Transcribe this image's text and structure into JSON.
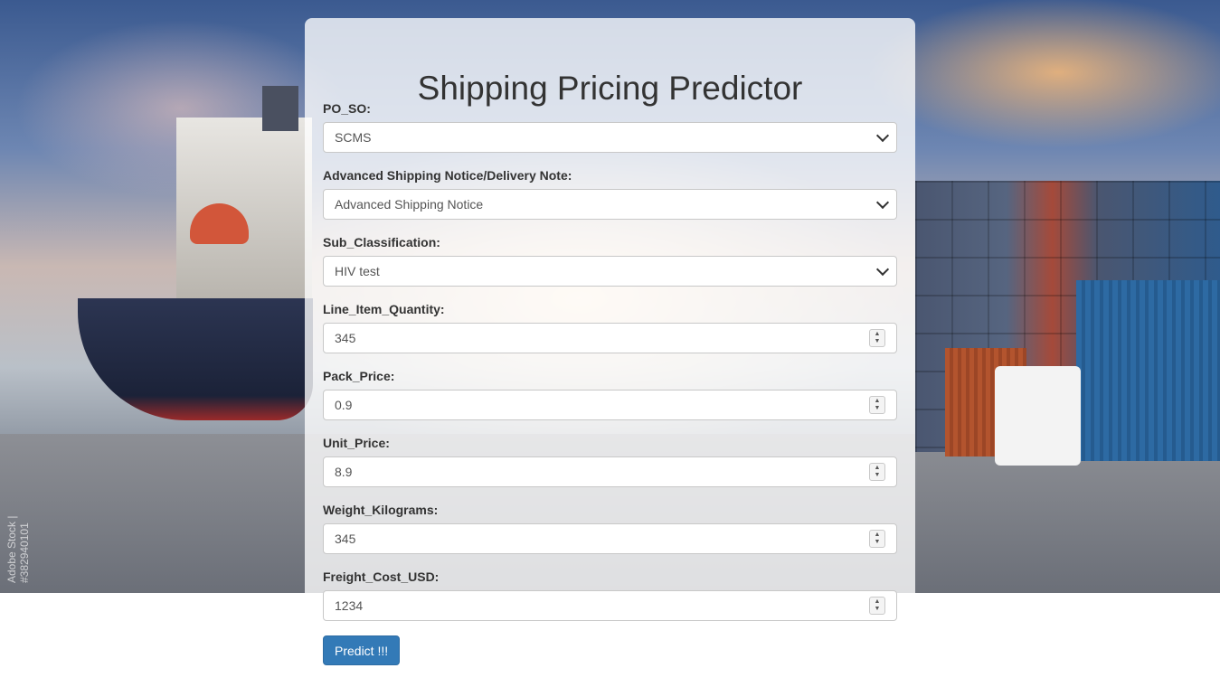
{
  "page": {
    "title": "Shipping Pricing Predictor"
  },
  "background": {
    "watermark": "Adobe Stock | #382940101"
  },
  "form": {
    "fields": [
      {
        "label": "PO_SO:",
        "type": "select",
        "value": "SCMS"
      },
      {
        "label": "Advanced Shipping Notice/Delivery Note:",
        "type": "select",
        "value": "Advanced Shipping Notice"
      },
      {
        "label": "Sub_Classification:",
        "type": "select",
        "value": "HIV test"
      },
      {
        "label": "Line_Item_Quantity:",
        "type": "number",
        "value": "345"
      },
      {
        "label": "Pack_Price:",
        "type": "number",
        "value": "0.9"
      },
      {
        "label": "Unit_Price:",
        "type": "number",
        "value": "8.9"
      },
      {
        "label": "Weight_Kilograms:",
        "type": "number",
        "value": "345"
      },
      {
        "label": "Freight_Cost_USD:",
        "type": "number",
        "value": "1234"
      }
    ],
    "submit_label": "Predict !!!"
  },
  "colors": {
    "button": "#337ab7",
    "text": "#333333"
  }
}
